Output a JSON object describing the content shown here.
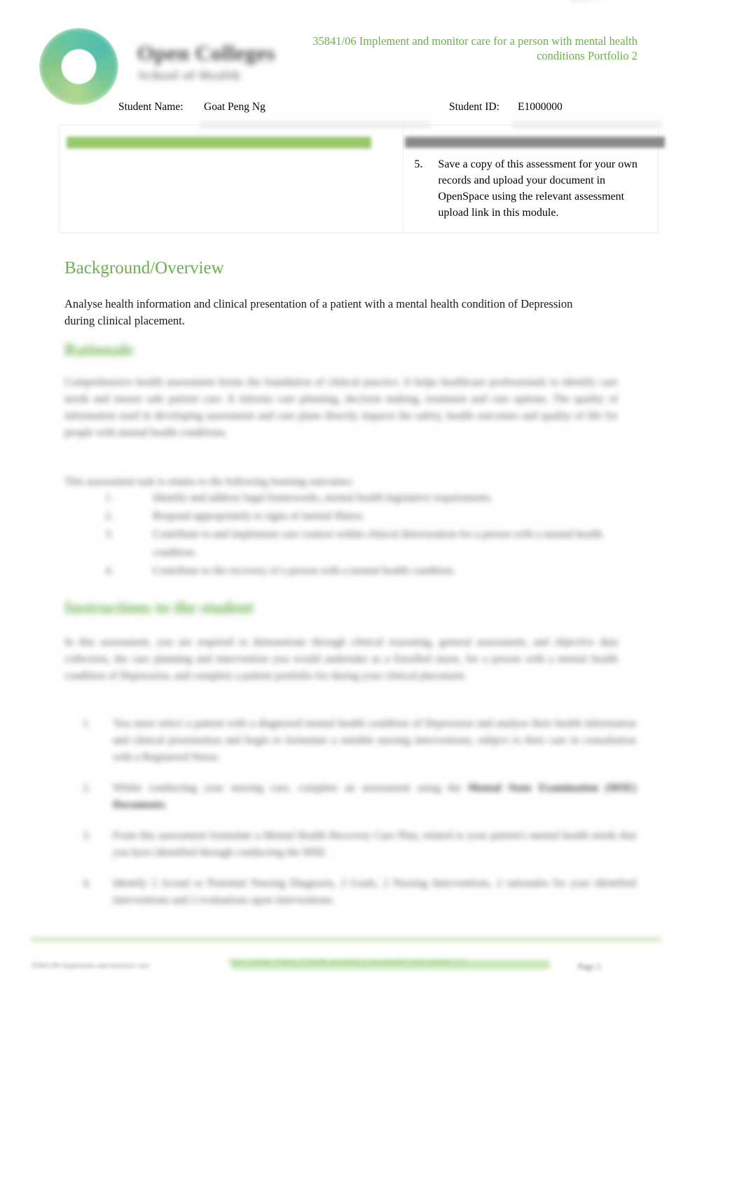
{
  "header": {
    "logo": {
      "ring_icon": "open-colleges-ring-logo",
      "wordmark": "Open Colleges",
      "sub_wordmark": "School of Health"
    },
    "document_title": "35841/06 Implement and monitor care for a person with mental health conditions Portfolio 2",
    "accent_color": "#6ab04c"
  },
  "student": {
    "name_label": "Student Name:",
    "name_value": "Goat Peng Ng",
    "id_label": "Student ID:",
    "id_value": "E1000000"
  },
  "instruction_table": {
    "left_cell": {
      "header_bar_color": "#96c96a",
      "header_text": "",
      "body_text": ""
    },
    "right_cell": {
      "header_bar_color": "#8a8a8a",
      "header_text": "",
      "items": [
        {
          "number": "5.",
          "text": "Save a copy of this assessment for your own records and upload your document in OpenSpace using the relevant assessment upload link in this module."
        }
      ]
    }
  },
  "sections": {
    "background": {
      "heading": "Background/Overview",
      "paragraph": "Analyse health information and clinical presentation of a patient with a mental health condition of Depression during clinical placement."
    },
    "rationale": {
      "heading": "Rationale",
      "paragraph_1": "Comprehensive health assessment forms the foundation of clinical practice. It helps healthcare professionals to identify care needs and ensure safe patient care. It informs care planning, decision making, treatment and care options. The quality of information used in developing assessment and care plans directly impacts the safety, health outcomes and quality of life for people with mental health conditions.",
      "paragraph_2": "This assessment task is relates to the following learning outcomes:",
      "list": [
        {
          "marker": "1.",
          "text": "Identify and address legal frameworks, mental health legislative requirements."
        },
        {
          "marker": "2.",
          "text": "Respond appropriately to signs of mental illness."
        },
        {
          "marker": "3.",
          "text": "Contribute to and implement care context within clinical deterioration for a person with a mental health condition."
        },
        {
          "marker": "4.",
          "text": "Contribute to the recovery of a person with a mental health condition."
        }
      ]
    },
    "instructions": {
      "heading": "Instructions to the student",
      "intro": "In this assessment, you are required to demonstrate through clinical reasoning, general assessment, and objective data collection, the care planning and intervention you would undertake as a Enrolled nurse, for a person with a mental health condition of Depression, and complete a patient portfolio for during your clinical placement.",
      "items": [
        {
          "marker": "1.",
          "text": "You must select a patient with a diagnosed mental health condition of Depression and analyse their health information and clinical presentation and begin to formulate a suitable nursing interventions, subject to their care in consultation with a Registered Nurse."
        },
        {
          "marker": "2.",
          "text": "Whilst conducting your nursing care, complete an assessment using the ",
          "bold": "Mental State Examination (MSE) Documents",
          "text_after": "."
        },
        {
          "marker": "3.",
          "text": "From this assessment formulate a Mental Health Recovery Care Plan, related to your patient's mental health needs that you have identified through conducting the MSE."
        },
        {
          "marker": "4.",
          "text": "Identify 2 Actual or Potential Nursing Diagnosis, 2 Goals, 2 Nursing Interventions, 2 rationales for your identified interventions and 2 evaluations upon interventions."
        }
      ]
    }
  },
  "footer": {
    "left_text": "35841/06 Implement and monitor care",
    "center_text": "Open Colleges School of Health document is uncontrolled when printed v1.0",
    "page_label": "Page 2",
    "rule_color": "#cfe6c0"
  }
}
